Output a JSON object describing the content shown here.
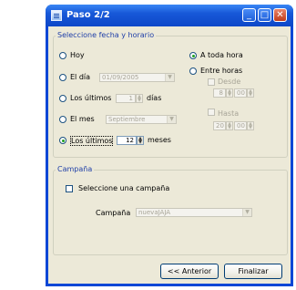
{
  "window": {
    "title": "Paso 2/2",
    "min_glyph": "_",
    "max_glyph": "□",
    "close_glyph": "✕"
  },
  "fecha_group": {
    "legend": "Seleccione fecha y horario",
    "options": {
      "hoy": "Hoy",
      "el_dia": "El día",
      "los_ultimos_dias": "Los últimos",
      "el_mes": "El mes",
      "los_ultimos_meses": "Los últimos"
    },
    "el_dia_value": "01/09/2005",
    "dias_value": "1",
    "dias_unit": "días",
    "mes_value": "Septiembre",
    "meses_value": "12",
    "meses_unit": "meses",
    "selected": "los_ultimos_meses"
  },
  "horario": {
    "a_toda_hora": "A toda hora",
    "entre_horas": "Entre horas",
    "desde": "Desde",
    "desde_hour": "8",
    "desde_min": "00",
    "hasta": "Hasta",
    "hasta_hour": "20",
    "hasta_min": "00",
    "selected": "a_toda_hora"
  },
  "campana_group": {
    "legend": "Campaña",
    "checkbox_label": "Seleccione una campaña",
    "checked": false,
    "campana_label": "Campaña",
    "campana_value": "nuevaJAJA"
  },
  "buttons": {
    "anterior": "<< Anterior",
    "finalizar": "Finalizar"
  },
  "colors": {
    "title_bar": "#0a47d6",
    "legend_text": "#1f3fa8",
    "radio_selected": "#21a121"
  }
}
